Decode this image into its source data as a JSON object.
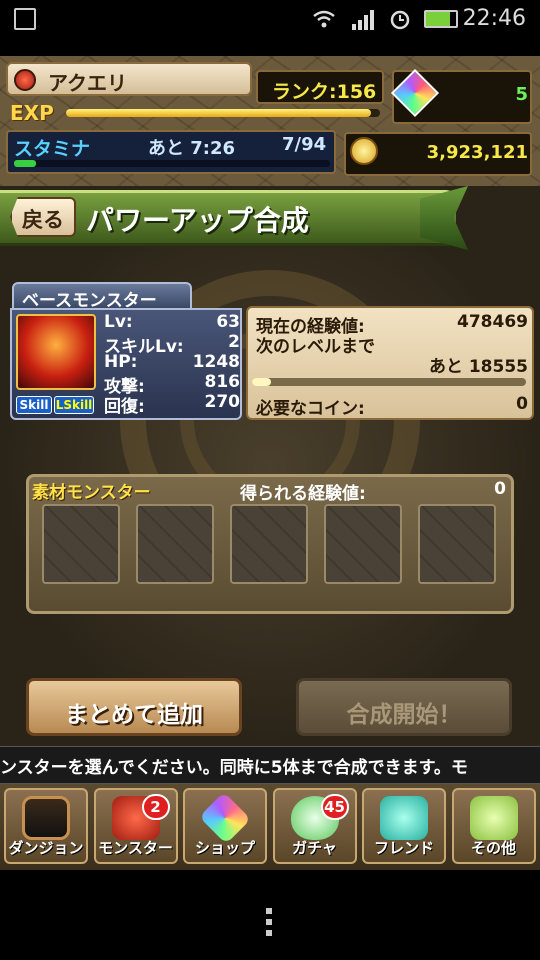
{
  "status_bar": {
    "time": "22:46",
    "icons": [
      "picture-icon",
      "wifi-icon",
      "signal-icon",
      "alarm-icon",
      "battery-icon"
    ]
  },
  "player": {
    "name": "アクエリ",
    "rank": "ランク:156",
    "exp_label": "EXP",
    "exp_progress": 0.97,
    "stamina_label": "スタミナ",
    "stamina_remaining": "あと 7:26",
    "stamina_count": "7/94",
    "stamina_progress": 0.07,
    "magic_stones": "5",
    "coins": "3,923,121"
  },
  "screen": {
    "back_label": "戻る",
    "title": "パワーアップ合成"
  },
  "base_monster": {
    "tab_label": "ベースモンスター",
    "skill_badge": "Skill",
    "lskill_badge": "LSkill",
    "stats": [
      {
        "label": "Lv:",
        "value": "63"
      },
      {
        "label": "スキルLv:",
        "value": "2"
      },
      {
        "label": "HP:",
        "value": "1248"
      },
      {
        "label": "攻撃:",
        "value": "816"
      },
      {
        "label": "回復:",
        "value": "270"
      }
    ]
  },
  "exp_info": {
    "current_label": "現在の経験値:",
    "current_value": "478469",
    "next_label": "次のレベルまで",
    "next_value": "あと 18555",
    "next_progress": 0.07,
    "coin_label": "必要なコイン:",
    "coin_value": "0"
  },
  "materials": {
    "label": "素材モンスター",
    "exp_label": "得られる経験値:",
    "exp_value": "0",
    "slot_count": 5
  },
  "buttons": {
    "add": "まとめて追加",
    "start": "合成開始！"
  },
  "ticker": "ンスターを選んでください。同時に5体まで合成できます。モ",
  "nav": [
    {
      "label": "ダンジョン",
      "icon": "dungeon-gate-icon",
      "badge": ""
    },
    {
      "label": "モンスター",
      "icon": "dragon-icon",
      "badge": "2"
    },
    {
      "label": "ショップ",
      "icon": "gem-icon",
      "badge": ""
    },
    {
      "label": "ガチャ",
      "icon": "egg-icon",
      "badge": "45"
    },
    {
      "label": "フレンド",
      "icon": "friends-icon",
      "badge": ""
    },
    {
      "label": "その他",
      "icon": "question-icon",
      "badge": ""
    }
  ]
}
